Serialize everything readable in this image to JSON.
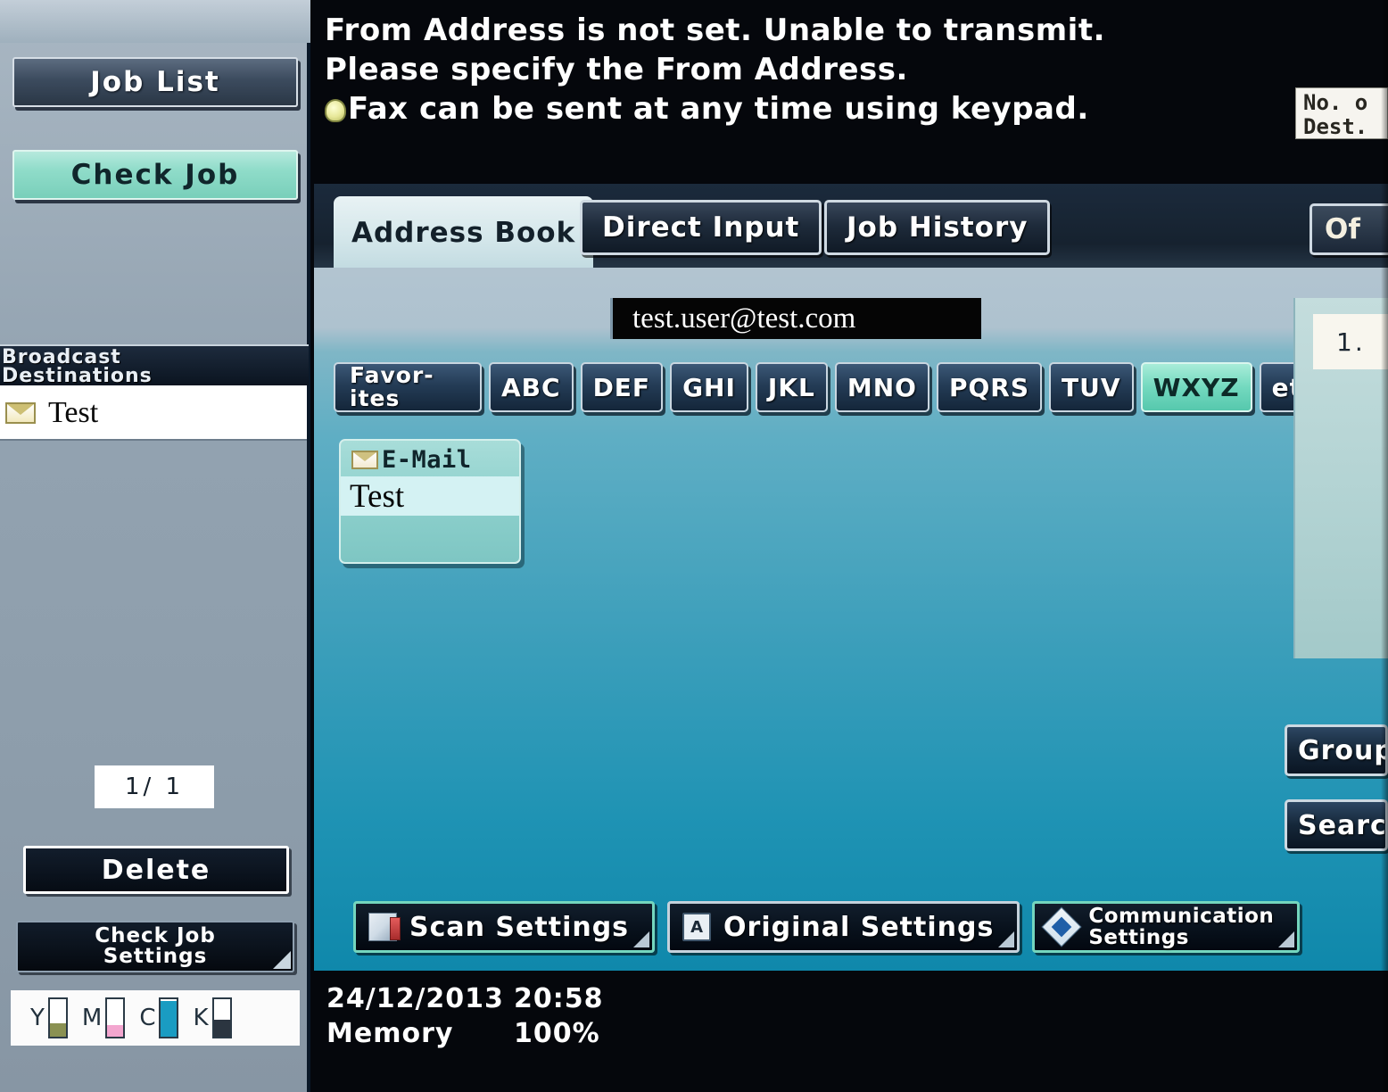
{
  "message": {
    "line1": "From Address is not set. Unable to transmit.",
    "line2": "Please specify the From Address.",
    "line3": "Fax can be sent at any time using keypad."
  },
  "destination_counter": {
    "line1": "No. o",
    "line2": "Dest."
  },
  "sidebar": {
    "job_list_label": "Job List",
    "check_job_label": "Check Job",
    "broadcast_header_line1": "Broadcast",
    "broadcast_header_line2": "Destinations",
    "broadcast_items": [
      {
        "icon": "envelope-icon",
        "name": "Test"
      }
    ],
    "page_indicator": "1/  1",
    "delete_label": "Delete",
    "check_job_settings_line1": "Check Job",
    "check_job_settings_line2": "Settings",
    "toner": [
      {
        "label": "Y",
        "level": 35,
        "color": "#8a9152"
      },
      {
        "label": "M",
        "level": 30,
        "color": "#f3a6cf"
      },
      {
        "label": "C",
        "level": 95,
        "color": "#1a9cc2"
      },
      {
        "label": "K",
        "level": 45,
        "color": "#2b3540"
      }
    ]
  },
  "tabs": [
    {
      "label": "Address Book",
      "active": true
    },
    {
      "label": "Direct Input",
      "active": false
    },
    {
      "label": "Job History",
      "active": false
    }
  ],
  "offhook_label": "Of",
  "email_field": {
    "value": "test.user@test.com"
  },
  "alpha_filters": [
    {
      "label": "Favor-",
      "label2": "ites",
      "selected": false,
      "two_line": true
    },
    {
      "label": "ABC",
      "selected": false
    },
    {
      "label": "DEF",
      "selected": false
    },
    {
      "label": "GHI",
      "selected": false
    },
    {
      "label": "JKL",
      "selected": false
    },
    {
      "label": "MNO",
      "selected": false
    },
    {
      "label": "PQRS",
      "selected": false
    },
    {
      "label": "TUV",
      "selected": false
    },
    {
      "label": "WXYZ",
      "selected": true
    },
    {
      "label": "etc",
      "selected": false
    }
  ],
  "address_cards": [
    {
      "type": "E-Mail",
      "name": "Test",
      "icon": "envelope-icon"
    }
  ],
  "right_panel": {
    "page_count": "1.",
    "group_label": "Group",
    "search_label": "Search"
  },
  "bottom_buttons": [
    {
      "label": "Scan Settings",
      "icon": "scan-icon",
      "border": "green",
      "two_line": false
    },
    {
      "label": "Original Settings",
      "icon": "original-icon",
      "border": "gray",
      "two_line": false
    },
    {
      "label": "Communication",
      "label2": "Settings",
      "icon": "communication-icon",
      "border": "green",
      "two_line": true
    }
  ],
  "status_bar": {
    "date": "24/12/2013",
    "time": "20:58",
    "memory_label": "Memory",
    "memory_value": "100%"
  },
  "colors": {
    "accent_green": "#74d6be",
    "panel_top": "#aec2cf",
    "panel_bottom": "#0f88ab",
    "sidebar_bg": "#93a3b1",
    "dark_bg": "#05070c"
  }
}
